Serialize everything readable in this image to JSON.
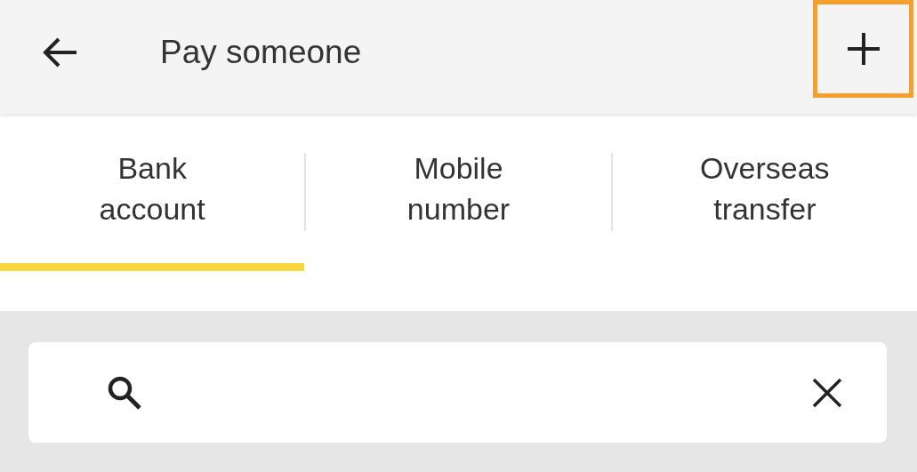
{
  "app_bar": {
    "title": "Pay someone",
    "add_highlighted": true
  },
  "tabs": [
    {
      "label": "Bank account",
      "selected": true
    },
    {
      "label": "Mobile number",
      "selected": false
    },
    {
      "label": "Overseas transfer",
      "selected": false
    }
  ]
}
